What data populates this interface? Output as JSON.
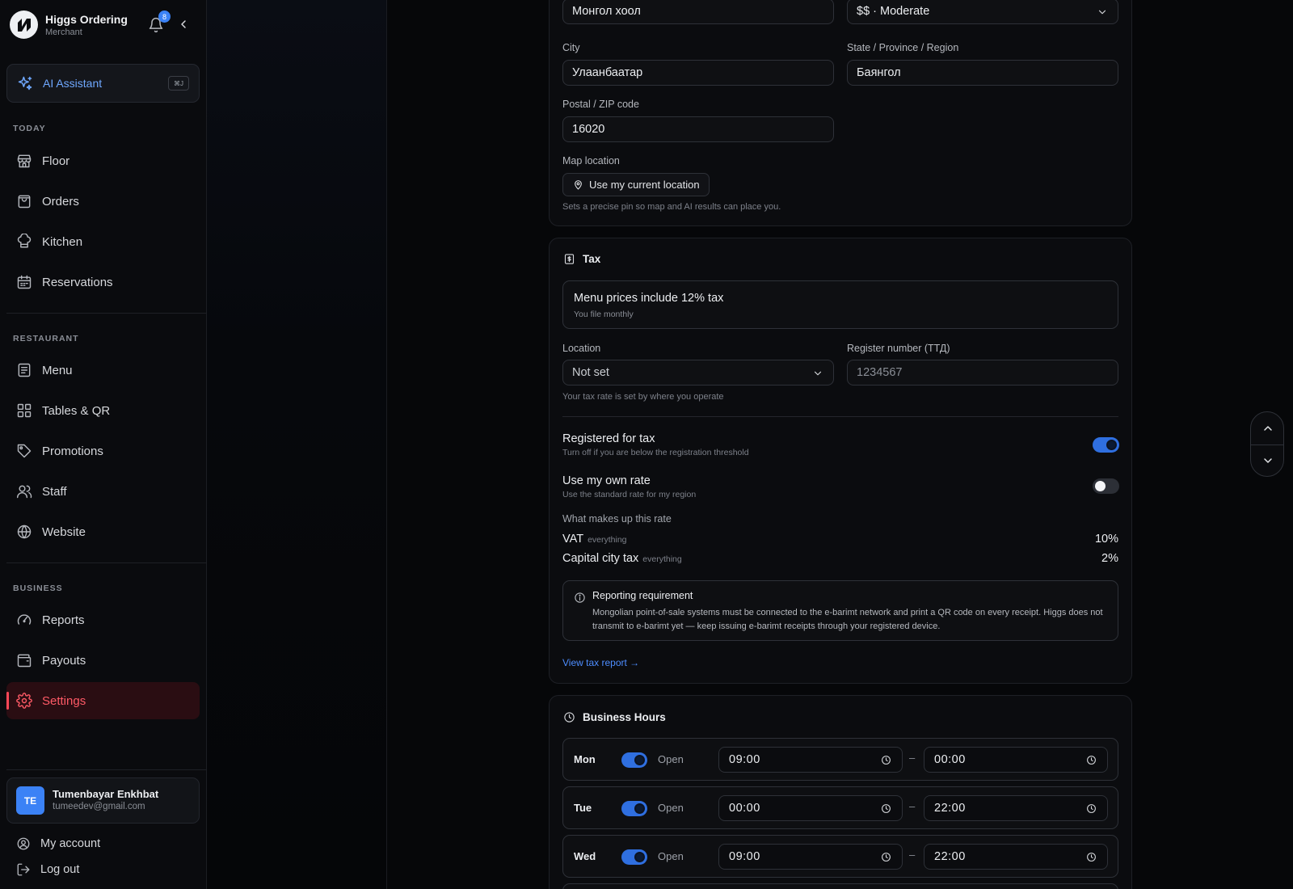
{
  "brand": {
    "name": "Higgs Ordering",
    "role": "Merchant",
    "notifications": "8"
  },
  "ai": {
    "label": "AI Assistant",
    "shortcut": "⌘J"
  },
  "nav": {
    "today_label": "TODAY",
    "today": [
      {
        "label": "Floor",
        "icon": "store-icon"
      },
      {
        "label": "Orders",
        "icon": "bag-icon"
      },
      {
        "label": "Kitchen",
        "icon": "chef-hat-icon"
      },
      {
        "label": "Reservations",
        "icon": "calendar-icon"
      }
    ],
    "restaurant_label": "RESTAURANT",
    "restaurant": [
      {
        "label": "Menu",
        "icon": "menu-list-icon"
      },
      {
        "label": "Tables & QR",
        "icon": "grid-icon"
      },
      {
        "label": "Promotions",
        "icon": "tag-icon"
      },
      {
        "label": "Staff",
        "icon": "users-icon"
      },
      {
        "label": "Website",
        "icon": "globe-icon"
      }
    ],
    "business_label": "BUSINESS",
    "business": [
      {
        "label": "Reports",
        "icon": "gauge-icon"
      },
      {
        "label": "Payouts",
        "icon": "wallet-icon"
      },
      {
        "label": "Settings",
        "icon": "gear-icon",
        "active": true
      }
    ]
  },
  "user": {
    "initials": "TE",
    "name": "Tumenbayar Enkhbat",
    "email": "tumeedev@gmail.com"
  },
  "account": {
    "my_account": "My account",
    "log_out": "Log out"
  },
  "location": {
    "cuisine_value": "Монгол хоол",
    "price_value": "$$ · Moderate",
    "city_label": "City",
    "city_value": "Улаанбаатар",
    "state_label": "State / Province / Region",
    "state_value": "Баянгол",
    "postal_label": "Postal / ZIP code",
    "postal_value": "16020",
    "map_label": "Map location",
    "map_button": "Use my current location",
    "map_hint": "Sets a precise pin so map and AI results can place you."
  },
  "tax": {
    "title": "Tax",
    "banner_title": "Menu prices include 12% tax",
    "banner_sub": "You file monthly",
    "location_label": "Location",
    "location_value": "Not set",
    "register_label": "Register number (ТТД)",
    "register_placeholder": "1234567",
    "rate_hint": "Your tax rate is set by where you operate",
    "registered_title": "Registered for tax",
    "registered_sub": "Turn off if you are below the registration threshold",
    "registered_on": true,
    "own_rate_title": "Use my own rate",
    "own_rate_sub": "Use the standard rate for my region",
    "own_rate_on": false,
    "makeup_label": "What makes up this rate",
    "rates": [
      {
        "name": "VAT",
        "scope": "everything",
        "value": "10%"
      },
      {
        "name": "Capital city tax",
        "scope": "everything",
        "value": "2%"
      }
    ],
    "notice_title": "Reporting requirement",
    "notice_body": "Mongolian point-of-sale systems must be connected to the e-barimt network and print a QR code on every receipt. Higgs does not transmit to e-barimt yet — keep issuing e-barimt receipts through your registered device.",
    "report_link": "View tax report →"
  },
  "hours": {
    "title": "Business Hours",
    "open_label": "Open",
    "separator": "–",
    "rows": [
      {
        "day": "Mon",
        "open": true,
        "from": "09:00",
        "to": "00:00"
      },
      {
        "day": "Tue",
        "open": true,
        "from": "00:00",
        "to": "22:00"
      },
      {
        "day": "Wed",
        "open": true,
        "from": "09:00",
        "to": "22:00"
      }
    ]
  },
  "colors": {
    "accent": "#3b82f6",
    "danger": "#ff5a66",
    "link": "#4d8dff"
  }
}
